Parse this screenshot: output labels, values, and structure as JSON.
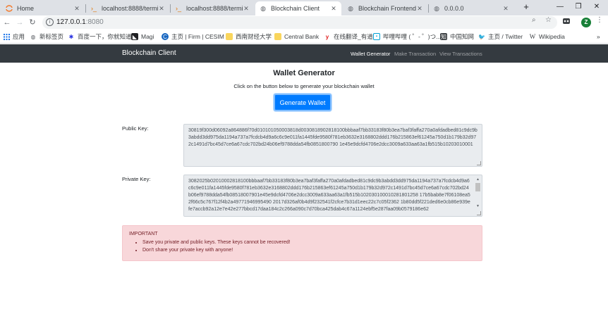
{
  "browser": {
    "tabs": [
      {
        "title": "Home",
        "icon": "jupyter-icon"
      },
      {
        "title": "localhost:8888/termina",
        "icon": "terminal-icon"
      },
      {
        "title": "localhost:8888/termina",
        "icon": "terminal-icon"
      },
      {
        "title": "Blockchain Client",
        "icon": "globe-icon",
        "active": true
      },
      {
        "title": "Blockchain Frontend",
        "icon": "globe-icon"
      },
      {
        "title": "0.0.0.0",
        "icon": "globe-icon"
      }
    ],
    "new_tab": "+",
    "window_controls": {
      "minimize": "—",
      "maximize": "❐",
      "close": "✕"
    },
    "address_host": "127.0.0.1",
    "address_port": ":8080",
    "profile_initial": "Z",
    "bookmarks": [
      {
        "label": "应用",
        "icon": "apps-grid-icon"
      },
      {
        "label": "新标签页",
        "icon": "globe-icon"
      },
      {
        "label": "百度一下，你就知道",
        "icon": "baidu-paw-icon"
      },
      {
        "label": "Magi",
        "icon": "magi-icon"
      },
      {
        "label": "主页 | Firm | CESIM",
        "icon": "cesim-icon"
      },
      {
        "label": "西南财经大学",
        "icon": "folder-icon"
      },
      {
        "label": "Central Bank",
        "icon": "folder-icon"
      },
      {
        "label": "在线翻译_有道",
        "icon": "youdao-icon"
      },
      {
        "label": "哔哩哔哩 ( ゜- ゜)つ...",
        "icon": "bilibili-icon"
      },
      {
        "label": "中国知网",
        "icon": "cnki-icon"
      },
      {
        "label": "主页 / Twitter",
        "icon": "twitter-icon"
      },
      {
        "label": "Wikipedia",
        "icon": "wikipedia-icon"
      }
    ],
    "bookmarks_overflow": "»"
  },
  "app": {
    "brand": "Blockchain Client",
    "nav": [
      {
        "label": "Wallet Generator",
        "active": true
      },
      {
        "label": "Make Transaction",
        "active": false
      },
      {
        "label": "View Transactions",
        "active": false
      }
    ]
  },
  "main": {
    "title": "Wallet Generator",
    "subtitle": "Click on the button below to generate your blockchain wallet",
    "generate_button": "Generate Wallet",
    "public_key_label": "Public Key:",
    "public_key": "30819f300d06092a864886f70d010101050003818d0030818902818100bbbaaf7bb33183f80b3ea7baf3faffa270a0afdadbed81c9dc9b3abdd3dd975da1194a737a7fcdcb4d9a6c6c9e011fa1445fde9580f781eb3632e3168802ddd176b215863ef61245a750d1b179b32d972c1491d7bc45d7ce6a67cdc702bd24b06ef9788dda54fb0851800790 1e45e9dcfd4706e2dcc3009a633aa63a1fb515b10203010001",
    "private_key_label": "Private Key:",
    "private_key": "3082025b02010002818100bbbaaf7bb33183f80b3ea7baf3faffa270a0afdadbed81c9dc9b3abdd3dd975da1194a737a7fcdcb4d9a6c6c9e011fa1445fde9580f781eb3632e3168802ddd176b215863ef61245a750d1b179b32d972c1491d7bc45d7ce6a67cdc702bd24b06ef9788dda54fb08518007901e45e9dcfd4706e2dcc3009a633aa63a1fb515b102030100010281801258 17b5bab8e7f06108ea52f66c5c767f12f4b2a49771946995490 2017d326af0b4d9f232541f2cfce7b31d1eec22c7c05f2362 1b80dd5f221ded6e0cb86e939efe7accb92a12e7e42e277bbcd17daa184c2c266a090c7d70bca425dab4c67a1124ebf5e287faa09b0579186e62",
    "alert": {
      "title": "IMPORTANT",
      "items": [
        "Save you private and public keys. These keys cannot be recovered!",
        "Don't share your private key with anyone!"
      ]
    }
  }
}
